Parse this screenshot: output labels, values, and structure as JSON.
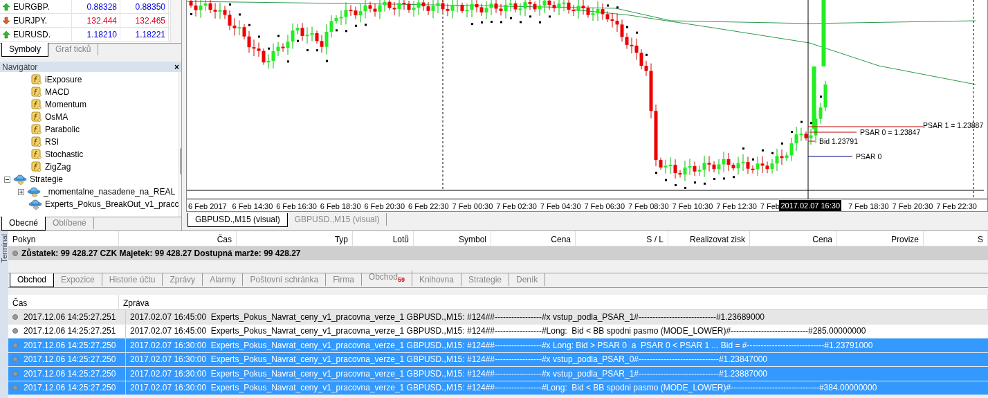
{
  "market_watch": {
    "rows": [
      {
        "symbol": "EURGBP.",
        "rising": true,
        "bid": "0.88328",
        "ask": "0.88350"
      },
      {
        "symbol": "EURJPY.",
        "rising": false,
        "bid": "132.444",
        "ask": "132.465"
      },
      {
        "symbol": "EURUSD.",
        "rising": true,
        "bid": "1.18210",
        "ask": "1.18221"
      }
    ],
    "tabs": [
      {
        "label": "Symboly",
        "selected": true
      },
      {
        "label": "Graf ticků",
        "selected": false
      }
    ]
  },
  "navigator": {
    "title": "Navigátor",
    "close": "×",
    "indicators": [
      {
        "label": "iExposure"
      },
      {
        "label": "MACD"
      },
      {
        "label": "Momentum"
      },
      {
        "label": "OsMA"
      },
      {
        "label": "Parabolic"
      },
      {
        "label": "RSI"
      },
      {
        "label": "Stochastic"
      },
      {
        "label": "ZigZag"
      }
    ],
    "items": [
      {
        "label": "Strategie",
        "kind": "folder",
        "expanded": true,
        "children": [
          {
            "label": "_momentalne_nasadene_na_REAL",
            "kind": "folder",
            "expanded": false
          },
          {
            "label": "Experts_Pokus_BreakOut_v1_pracc",
            "kind": "expert"
          }
        ]
      }
    ],
    "tabs": [
      {
        "label": "Obecné",
        "selected": true
      },
      {
        "label": "Oblíbené",
        "selected": false
      }
    ]
  },
  "chart": {
    "labels": [
      {
        "kind": "psar1",
        "text": "PSAR 1 = 1.23887"
      },
      {
        "kind": "psar0value",
        "text": "PSAR 0 = 1.23847"
      },
      {
        "kind": "bid",
        "text": "Bid 1.23791"
      },
      {
        "kind": "psar0",
        "text": "PSAR 0"
      }
    ],
    "xaxis": [
      "6 Feb 2017",
      "6 Feb 14:30",
      "6 Feb 16:30",
      "6 Feb 18:30",
      "6 Feb 20:30",
      "6 Feb 22:30",
      "7 Feb 00:30",
      "7 Feb 02:30",
      "7 Feb 04:30",
      "7 Feb 06:30",
      "7 Feb 08:30",
      "7 Feb 10:30",
      "7 Feb 12:30",
      "7 Feb",
      {
        "kind": "crosshair",
        "label": "2017.02.07 16:30"
      },
      "7 Feb 18:30",
      "7 Feb 20:30",
      "7 Feb 22:30"
    ],
    "tabs": [
      {
        "label": "GBPUSD.,M15 (visual)",
        "selected": true
      },
      {
        "label": "GBPUSD.,M15 (visual)",
        "selected": false
      }
    ]
  },
  "terminal": {
    "title": "Terminal",
    "columns": [
      "Pokyn",
      "Čas",
      "Typ",
      "Lotů",
      "Symbol",
      "Cena",
      "S / L",
      "Realizovat zisk",
      "Cena",
      "Provize",
      "S"
    ],
    "balance": "Zůstatek: 99 428.27 CZK  Majetek: 99 428.27  Dostupná marže: 99 428.27",
    "tabs": [
      {
        "label": "Obchod",
        "selected": true
      },
      {
        "label": "Expozice",
        "selected": false
      },
      {
        "label": "Historie účtu",
        "selected": false
      },
      {
        "label": "Zprávy",
        "selected": false
      },
      {
        "label": "Alarmy",
        "selected": false
      },
      {
        "label": "Poštovní schránka",
        "selected": false
      },
      {
        "label": "Firma",
        "selected": false
      },
      {
        "label": "Obchod",
        "badge": "59",
        "selected": false
      },
      {
        "label": "Knihovna",
        "selected": false
      },
      {
        "label": "Strategie",
        "selected": false
      },
      {
        "label": "Deník",
        "selected": false
      }
    ]
  },
  "journal": {
    "columns": [
      "Čas",
      "Zpráva"
    ],
    "rows": [
      {
        "time": "2017.12.06 14:25:27.251",
        "date": "2017.02.07 16:45:00",
        "message": "Experts_Pokus_Navrat_ceny_v1_pracovna_verze_1 GBPUSD.,M15: #124##-----------------#x vstup_podla_PSAR_1#----------------------------#1.23689000",
        "selected": false,
        "hover": true
      },
      {
        "time": "2017.12.06 14:25:27.251",
        "date": "2017.02.07 16:45:00",
        "message": "Experts_Pokus_Navrat_ceny_v1_pracovna_verze_1 GBPUSD.,M15: #124##-----------------#Long:  Bid < BB spodni pasmo (MODE_LOWER)#----------------------------#285.00000000",
        "selected": false,
        "hover": false
      },
      {
        "time": "2017.12.06 14:25:27.250",
        "date": "2017.02.07 16:30:00",
        "message": "Experts_Pokus_Navrat_ceny_v1_pracovna_verze_1 GBPUSD.,M15: #124##-----------------#x Long: Bid > PSAR 0  a  PSAR 0 < PSAR 1 ... Bid = #----------------------------#1.23791000",
        "selected": true,
        "hover": false
      },
      {
        "time": "2017.12.06 14:25:27.250",
        "date": "2017.02.07 16:30:00",
        "message": "Experts_Pokus_Navrat_ceny_v1_pracovna_verze_1 GBPUSD.,M15: #124##-----------------#x vstup_podla_PSAR_0#-----------------------------#1.23847000",
        "selected": true,
        "hover": false
      },
      {
        "time": "2017.12.06 14:25:27.250",
        "date": "2017.02.07 16:30:00",
        "message": "Experts_Pokus_Navrat_ceny_v1_pracovna_verze_1 GBPUSD.,M15: #124##-----------------#x vstup_podla_PSAR_1#-----------------------------#1.23887000",
        "selected": true,
        "hover": false
      },
      {
        "time": "2017.12.06 14:25:27.250",
        "date": "2017.02.07 16:30:00",
        "message": "Experts_Pokus_Navrat_ceny_v1_pracovna_verze_1 GBPUSD.,M15: #124##-----------------#Long:  Bid < BB spodni pasmo (MODE_LOWER)#--------------------------------#384.00000000",
        "selected": true,
        "hover": false
      }
    ]
  }
}
